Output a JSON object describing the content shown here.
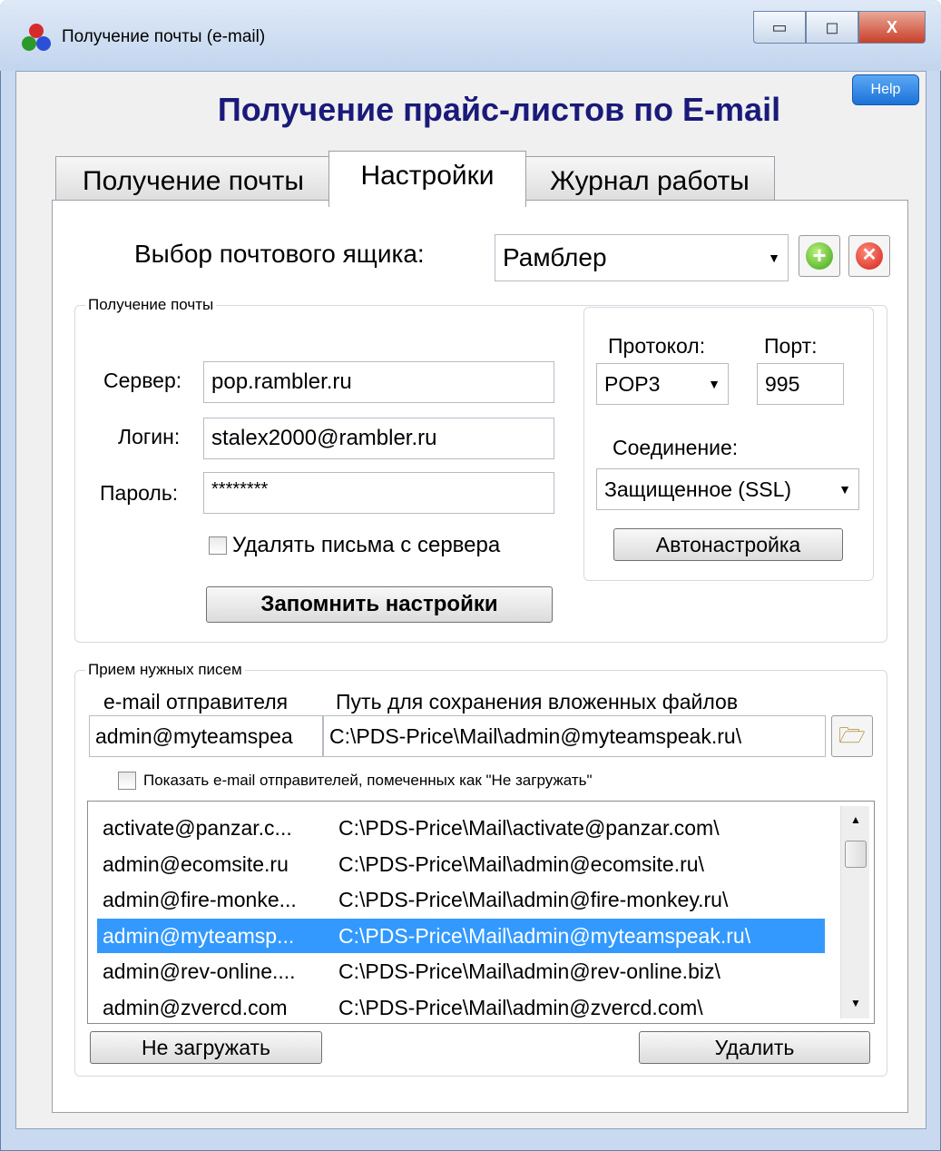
{
  "window": {
    "title": "Получение почты (e-mail)",
    "buttons": {
      "minimize": "▭",
      "maximize": "◻",
      "close": "X"
    }
  },
  "help_label": "Help",
  "main_title": "Получение прайс-листов по E-mail",
  "tabs": [
    {
      "label": "Получение почты"
    },
    {
      "label": "Настройки"
    },
    {
      "label": "Журнал работы"
    }
  ],
  "mailbox": {
    "label": "Выбор почтового ящика:",
    "value": "Рамблер"
  },
  "receive_group": {
    "caption": "Получение почты",
    "server_label": "Сервер:",
    "server_value": "pop.rambler.ru",
    "login_label": "Логин:",
    "login_value": "stalex2000@rambler.ru",
    "password_label": "Пароль:",
    "password_value": "********",
    "delete_label": "Удалять письма с сервера",
    "save_button": "Запомнить настройки",
    "protocol_label": "Протокол:",
    "protocol_value": "POP3",
    "port_label": "Порт:",
    "port_value": "995",
    "connection_label": "Соединение:",
    "connection_value": "Защищенное (SSL)",
    "autoconfig_button": "Автонастройка"
  },
  "mail_group": {
    "caption": "Прием нужных писем",
    "sender_header": "e-mail отправителя",
    "path_header": "Путь для сохранения вложенных файлов",
    "sender_value": "admin@myteamspea",
    "path_value": "C:\\PDS-Price\\Mail\\admin@myteamspeak.ru\\",
    "show_label": "Показать e-mail отправителей, помеченных как \"Не загружать\"",
    "rows": [
      {
        "email": "activate@panzar.c...",
        "path": "C:\\PDS-Price\\Mail\\activate@panzar.com\\"
      },
      {
        "email": "admin@ecomsite.ru",
        "path": "C:\\PDS-Price\\Mail\\admin@ecomsite.ru\\"
      },
      {
        "email": "admin@fire-monke...",
        "path": "C:\\PDS-Price\\Mail\\admin@fire-monkey.ru\\"
      },
      {
        "email": "admin@myteamsp...",
        "path": "C:\\PDS-Price\\Mail\\admin@myteamspeak.ru\\"
      },
      {
        "email": "admin@rev-online....",
        "path": "C:\\PDS-Price\\Mail\\admin@rev-online.biz\\"
      },
      {
        "email": "admin@zvercd.com",
        "path": "C:\\PDS-Price\\Mail\\admin@zvercd.com\\"
      }
    ],
    "selected_row": 3,
    "dont_load_button": "Не загружать",
    "delete_button": "Удалить"
  }
}
